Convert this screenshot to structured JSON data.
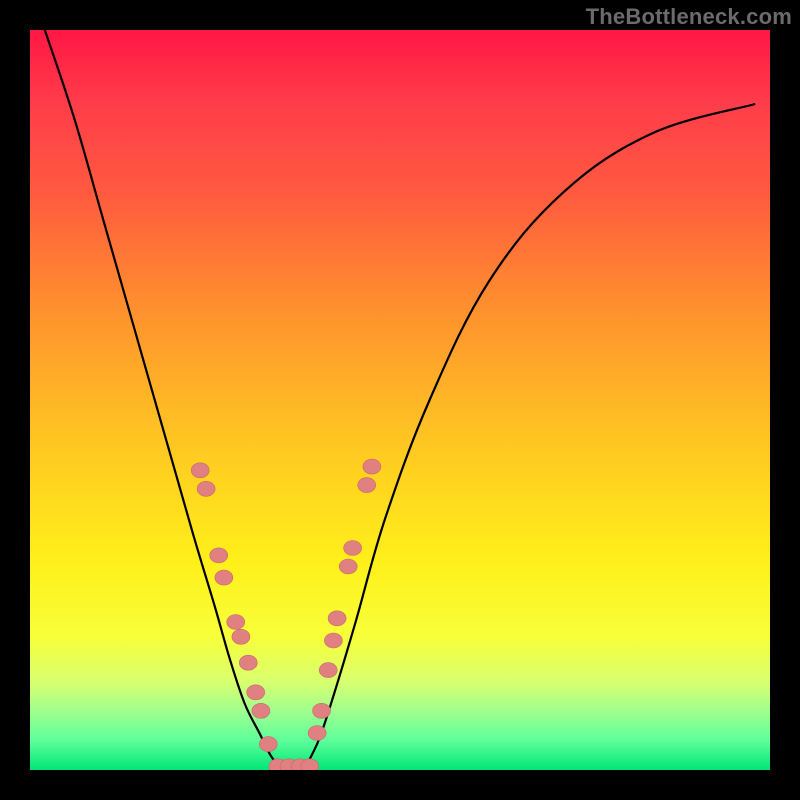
{
  "watermark": "TheBottleneck.com",
  "chart_data": {
    "type": "line",
    "title": "",
    "xlabel": "",
    "ylabel": "",
    "xlim": [
      0,
      100
    ],
    "ylim": [
      0,
      100
    ],
    "grid": false,
    "legend": false,
    "background_gradient": {
      "direction": "vertical",
      "stops": [
        {
          "pos": 0,
          "color": "#ff1744"
        },
        {
          "pos": 50,
          "color": "#ffd21f"
        },
        {
          "pos": 80,
          "color": "#f7ff3a"
        },
        {
          "pos": 100,
          "color": "#00e676"
        }
      ]
    },
    "series": [
      {
        "name": "left_curve",
        "x": [
          2,
          6,
          10,
          14,
          18,
          22,
          25,
          27,
          29,
          31,
          32.5,
          34
        ],
        "y": [
          100,
          88,
          74,
          60,
          46,
          32,
          22,
          15,
          9,
          5,
          2,
          0
        ]
      },
      {
        "name": "right_curve",
        "x": [
          37,
          39,
          41,
          44,
          48,
          54,
          62,
          72,
          84,
          98
        ],
        "y": [
          0,
          4,
          10,
          20,
          34,
          50,
          66,
          78,
          86,
          90
        ]
      }
    ],
    "markers": {
      "name": "bead_points",
      "color": "#e08080",
      "points": [
        {
          "x": 23.0,
          "y": 40.5
        },
        {
          "x": 23.8,
          "y": 38.0
        },
        {
          "x": 25.5,
          "y": 29.0
        },
        {
          "x": 26.2,
          "y": 26.0
        },
        {
          "x": 27.8,
          "y": 20.0
        },
        {
          "x": 28.5,
          "y": 18.0
        },
        {
          "x": 29.5,
          "y": 14.5
        },
        {
          "x": 30.5,
          "y": 10.5
        },
        {
          "x": 31.2,
          "y": 8.0
        },
        {
          "x": 32.2,
          "y": 3.5
        },
        {
          "x": 33.5,
          "y": 0.5
        },
        {
          "x": 35.0,
          "y": 0.5
        },
        {
          "x": 36.5,
          "y": 0.5
        },
        {
          "x": 37.8,
          "y": 0.5
        },
        {
          "x": 38.8,
          "y": 5.0
        },
        {
          "x": 39.4,
          "y": 8.0
        },
        {
          "x": 40.3,
          "y": 13.5
        },
        {
          "x": 41.0,
          "y": 17.5
        },
        {
          "x": 41.5,
          "y": 20.5
        },
        {
          "x": 43.0,
          "y": 27.5
        },
        {
          "x": 43.6,
          "y": 30.0
        },
        {
          "x": 45.5,
          "y": 38.5
        },
        {
          "x": 46.2,
          "y": 41.0
        }
      ]
    }
  }
}
